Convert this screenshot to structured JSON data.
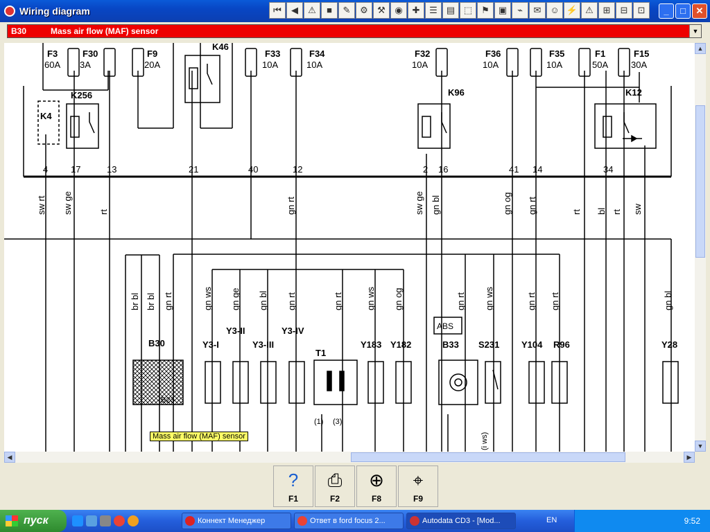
{
  "window": {
    "title": "Wiring diagram"
  },
  "component_select": {
    "code": "B30",
    "name": "Mass air flow (MAF) sensor"
  },
  "toolbar": {
    "icons": [
      "first-page-icon",
      "prev-page-icon",
      "warning-icon",
      "color-icon",
      "tool-1-icon",
      "tool-2-icon",
      "tool-3-icon",
      "tool-4-icon",
      "tool-5-icon",
      "tool-6-icon",
      "tool-7-icon",
      "tool-8-icon",
      "tool-9-icon",
      "tool-10-icon",
      "tool-11-icon",
      "tool-12-icon",
      "tool-13-icon",
      "tool-14-icon",
      "tool-15-icon",
      "tool-16-icon",
      "tool-17-icon",
      "tool-18-icon"
    ]
  },
  "diagram": {
    "fuses": [
      {
        "id": "F3",
        "rating": "60A"
      },
      {
        "id": "F30",
        "rating": "3A"
      },
      {
        "id": "F9",
        "rating": "20A"
      },
      {
        "id": "F33",
        "rating": "10A"
      },
      {
        "id": "F34",
        "rating": "10A"
      },
      {
        "id": "F32",
        "rating": "10A"
      },
      {
        "id": "F36",
        "rating": "10A"
      },
      {
        "id": "F35",
        "rating": "10A"
      },
      {
        "id": "F1",
        "rating": "50A"
      },
      {
        "id": "F15",
        "rating": "30A"
      }
    ],
    "relays": [
      "K4",
      "K256",
      "K46",
      "K96",
      "K12"
    ],
    "connector_pins": [
      "4",
      "17",
      "13",
      "21",
      "40",
      "12",
      "2",
      "16",
      "41",
      "14",
      "34"
    ],
    "wire_colors_top": [
      "sw rt",
      "sw ge",
      "rt",
      "gn rt",
      "sw ge",
      "gn bl",
      "gn og",
      "gn rt",
      "rt",
      "bl",
      "rt",
      "sw"
    ],
    "wire_colors_bottom": [
      "br bl",
      "br bl",
      "gn rt",
      "gn ws",
      "gn ge",
      "gn bl",
      "gn rt",
      "gn rt",
      "gn ws",
      "gn og",
      "gn rt",
      "gn ws",
      "gn rt",
      "gn rt",
      "gn bl"
    ],
    "components": [
      "B30",
      "Y3-I",
      "Y3-II",
      "Y3-III",
      "Y3-IV",
      "T1",
      "Y183",
      "Y182",
      "B33",
      "S231",
      "Y104",
      "R96",
      "Y28"
    ],
    "abs_label": "ABS",
    "b23_label": "B23",
    "t1_sub": [
      "(1)",
      "(3)"
    ],
    "s231_wire": "(i ws)",
    "tooltip": "Mass air flow (MAF) sensor"
  },
  "function_keys": [
    {
      "label": "F1",
      "icon": "help-icon"
    },
    {
      "label": "F2",
      "icon": "print-icon"
    },
    {
      "label": "F8",
      "icon": "zoom-icon"
    },
    {
      "label": "F9",
      "icon": "locate-icon"
    }
  ],
  "taskbar": {
    "start": "пуск",
    "tasks": [
      "Коннект Менеджер",
      "Ответ в ford focus 2...",
      "Autodata CD3 - [Mod..."
    ],
    "lang": "EN",
    "clock": "9:52"
  }
}
